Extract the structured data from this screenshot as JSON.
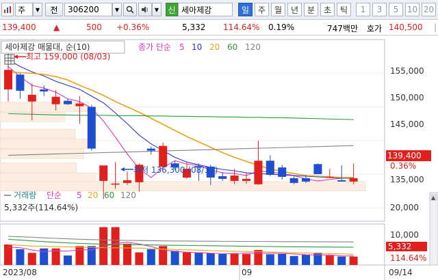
{
  "toolbar": {
    "market_label": "주",
    "prev_label": "전",
    "code_value": "306200",
    "search_icon": "search-icon",
    "sound_icon": "speaker-icon",
    "badge_label": "신",
    "stock_name": "세아제강",
    "periods": [
      "일",
      "주",
      "월",
      "년",
      "분",
      "초",
      "틱"
    ],
    "active_period": "일",
    "intervals": [
      "1",
      "3",
      "5",
      "10",
      "20"
    ]
  },
  "quote": {
    "price": "139,400",
    "change": "500",
    "change_pct": "+0.36%",
    "volume": "5,332",
    "volume_ratio": "114.64%",
    "turnover": "0.19%",
    "amount": "747백만",
    "ask_label": "호가",
    "ask_price": "140,500",
    "colors": {
      "up": "#e0201c",
      "down": "#1f4fd1"
    }
  },
  "price_chart": {
    "title": "세아제강 매물대, 순(10)",
    "legend_prefix": "종가 단순",
    "legend_periods": [
      "5",
      "10",
      "20",
      "60",
      "120"
    ],
    "legend_colors": [
      "#d63bb5",
      "#2b37c8",
      "#e8a31c",
      "#2a9a3c",
      "#808080"
    ],
    "high_annotation": "최고 159,000 (08/03)",
    "low_annotation": "최저 136,300 (08/17)",
    "y_ticks": [
      "155,000",
      "150,000",
      "145,000",
      "135,000"
    ],
    "last_price_label": "139,400",
    "last_change_label": "0.36%"
  },
  "volume_chart": {
    "title_label": "거래량",
    "legend_prefix": "단순",
    "legend_periods": [
      "5",
      "20",
      "60",
      "120"
    ],
    "legend_colors": [
      "#d63bb5",
      "#e8a31c",
      "#2a9a3c",
      "#808080"
    ],
    "current_label": "5,332주(114.64%)",
    "y_ticks": [
      "20,000",
      "10,000"
    ],
    "last_volume_label": "5,332",
    "last_ratio_label": "114.64%"
  },
  "x_axis": {
    "labels": [
      "2023/08",
      "09",
      "09/14"
    ]
  },
  "chart_data": {
    "type": "candlestick",
    "ylim": [
      133000,
      160000
    ],
    "volume_ylim": [
      0,
      26000
    ],
    "candles": [
      {
        "o": 152600,
        "h": 159000,
        "l": 150800,
        "c": 155500
      },
      {
        "o": 154800,
        "h": 155000,
        "l": 151200,
        "c": 152400
      },
      {
        "o": 150800,
        "h": 153500,
        "l": 148000,
        "c": 151800
      },
      {
        "o": 152600,
        "h": 153200,
        "l": 151600,
        "c": 152300
      },
      {
        "o": 150400,
        "h": 152500,
        "l": 149500,
        "c": 151500
      },
      {
        "o": 150900,
        "h": 151200,
        "l": 150300,
        "c": 150400
      },
      {
        "o": 150100,
        "h": 151600,
        "l": 147500,
        "c": 150500
      },
      {
        "o": 150000,
        "h": 150300,
        "l": 143500,
        "c": 143800
      },
      {
        "o": 139000,
        "h": 141200,
        "l": 136300,
        "c": 141300
      },
      {
        "o": 138600,
        "h": 141800,
        "l": 137800,
        "c": 138600
      },
      {
        "o": 138700,
        "h": 140400,
        "l": 138400,
        "c": 139100
      },
      {
        "o": 138800,
        "h": 141600,
        "l": 137400,
        "c": 141400
      },
      {
        "o": 143800,
        "h": 144100,
        "l": 142900,
        "c": 143500
      },
      {
        "o": 141100,
        "h": 144700,
        "l": 140900,
        "c": 144200
      },
      {
        "o": 141600,
        "h": 142000,
        "l": 140600,
        "c": 141000
      },
      {
        "o": 139500,
        "h": 141700,
        "l": 139300,
        "c": 140800
      },
      {
        "o": 141200,
        "h": 141600,
        "l": 139000,
        "c": 141000
      },
      {
        "o": 141100,
        "h": 141400,
        "l": 138400,
        "c": 139500
      },
      {
        "o": 139700,
        "h": 140300,
        "l": 139000,
        "c": 139300
      },
      {
        "o": 139000,
        "h": 140800,
        "l": 138500,
        "c": 139800
      },
      {
        "o": 139000,
        "h": 140200,
        "l": 138600,
        "c": 139300
      },
      {
        "o": 138500,
        "h": 145000,
        "l": 138400,
        "c": 142000
      },
      {
        "o": 142000,
        "h": 142800,
        "l": 139700,
        "c": 139900
      },
      {
        "o": 141000,
        "h": 141400,
        "l": 139200,
        "c": 139600
      },
      {
        "o": 139400,
        "h": 139900,
        "l": 138500,
        "c": 138700
      },
      {
        "o": 139400,
        "h": 139900,
        "l": 138700,
        "c": 138900
      },
      {
        "o": 141500,
        "h": 141600,
        "l": 140000,
        "c": 140000
      },
      {
        "o": 139600,
        "h": 140800,
        "l": 139400,
        "c": 139600
      },
      {
        "o": 139100,
        "h": 141300,
        "l": 138900,
        "c": 138900
      },
      {
        "o": 138900,
        "h": 141600,
        "l": 138500,
        "c": 139400
      }
    ],
    "volumes": [
      13000,
      10000,
      7700,
      10500,
      10500,
      6000,
      12000,
      12000,
      24000,
      24000,
      13500,
      8000,
      10000,
      12000,
      9000,
      8000,
      8000,
      7500,
      7000,
      7500,
      7000,
      9500,
      6800,
      7000,
      5700,
      6500,
      7800,
      6000,
      5400,
      5332
    ],
    "ma_volume_5": [
      11300,
      11000,
      9500,
      8500,
      9000,
      8800,
      9700,
      9500,
      11800,
      13500,
      14500,
      13300,
      11700,
      9600,
      8600,
      8100,
      7800,
      7500,
      7200,
      7100,
      7600,
      7400,
      7500,
      7300,
      7000,
      6500,
      6300,
      6400,
      5800,
      5700
    ],
    "ma_volume_20": [
      13000,
      12500,
      12000,
      11900,
      11700,
      11500,
      11300,
      11100,
      11000,
      10900,
      10800,
      10700,
      10400,
      10100,
      9800,
      9600,
      9400,
      9100,
      8900,
      8700,
      8600,
      8400,
      8200,
      8000,
      7800,
      7600,
      7400,
      7200,
      7000,
      6800
    ],
    "ma_volume_60": [
      16300,
      15800,
      15300,
      14800,
      14400,
      14000,
      13700,
      13400,
      13200,
      13000,
      12900,
      12800,
      12700,
      12600,
      12500,
      12400,
      12300,
      12200,
      12100,
      12000,
      11900,
      11800,
      11700,
      11600,
      11500,
      11500,
      11400,
      11400,
      11300,
      11300
    ],
    "ma_volume_120": [
      18200,
      17900,
      17600,
      17200,
      16900,
      16600,
      16300,
      16100,
      15900,
      15700,
      15600,
      15500,
      15400,
      15300,
      15200,
      15200,
      15100,
      15100,
      15000,
      15000,
      14900,
      14900,
      14900,
      14800,
      14800,
      14800,
      14700,
      14700,
      14700,
      14600
    ],
    "ma_5": [
      156000,
      154500,
      153200,
      152800,
      152200,
      151200,
      150800,
      149800,
      147900,
      145500,
      143000,
      140800,
      139500,
      141000,
      142000,
      141500,
      141300,
      140600,
      140200,
      140100,
      139800,
      140500,
      140300,
      140100,
      139800,
      139300,
      139000,
      139200,
      139400,
      139400
    ],
    "ma_10": [
      157000,
      156000,
      155200,
      154600,
      153800,
      153200,
      152600,
      151600,
      150600,
      149100,
      147500,
      145800,
      144500,
      143500,
      142500,
      141800,
      141400,
      141000,
      140700,
      140500,
      140200,
      140100,
      140000,
      139900,
      139800,
      139700,
      139600,
      139500,
      139400,
      139400
    ],
    "ma_20": [
      155200,
      155100,
      155000,
      154800,
      154500,
      154000,
      153200,
      152500,
      151700,
      150800,
      150000,
      149200,
      148300,
      147400,
      146500,
      145600,
      144800,
      144000,
      143200,
      142500,
      141900,
      141300,
      140800,
      140400,
      140100,
      139800,
      139700,
      139600,
      139500,
      139500
    ],
    "ma_60": [
      149000,
      148950,
      148900,
      148850,
      148800,
      148800,
      148750,
      148750,
      148750,
      148700,
      148700,
      148700,
      148650,
      148650,
      148600,
      148600,
      148550,
      148550,
      148500,
      148500,
      148450,
      148450,
      148400,
      148400,
      148350,
      148300,
      148250,
      148200,
      148150,
      148100
    ],
    "ma_120": [
      142800,
      142850,
      142900,
      142950,
      143000,
      143050,
      143100,
      143150,
      143200,
      143250,
      143300,
      143350,
      143400,
      143450,
      143500,
      143550,
      143600,
      143650,
      143700,
      143750,
      143800,
      143850,
      143900,
      143950,
      144000,
      144050,
      144100,
      144150,
      144200,
      144250
    ]
  }
}
